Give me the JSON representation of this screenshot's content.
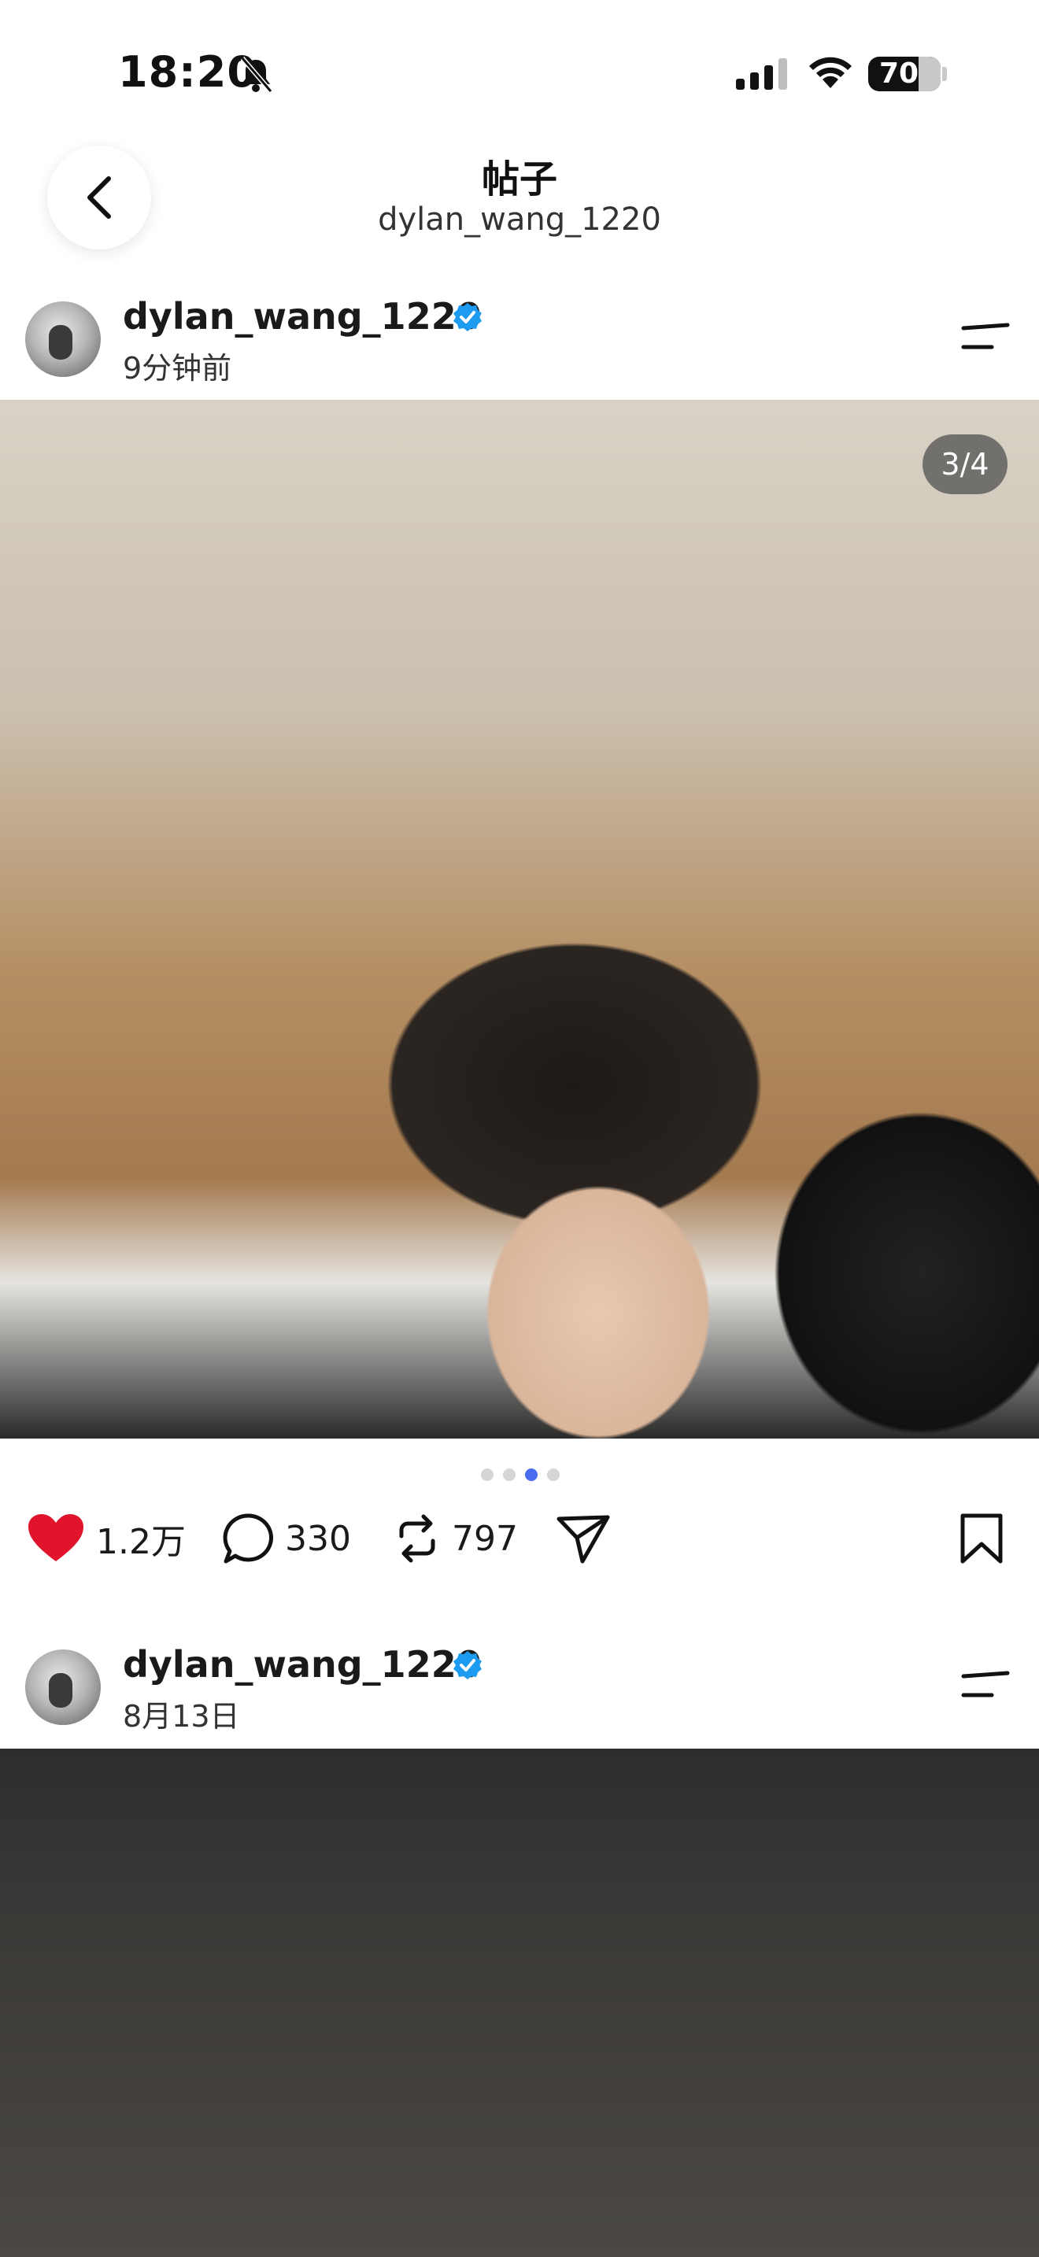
{
  "status_bar": {
    "time": "18:20",
    "battery": "70"
  },
  "header": {
    "title": "帖子",
    "subtitle": "dylan_wang_1220"
  },
  "posts": [
    {
      "username": "dylan_wang_1220",
      "time": "9分钟前",
      "image_counter": "3/4",
      "carousel": {
        "total": 4,
        "active_index": 3
      },
      "actions": {
        "likes": "1.2万",
        "comments": "330",
        "reposts": "797"
      },
      "liked": true
    },
    {
      "username": "dylan_wang_1220",
      "time": "8月13日"
    }
  ],
  "colors": {
    "like": "#e0152c",
    "verified": "#1d9bf0",
    "active_dot": "#4a6cf0"
  }
}
